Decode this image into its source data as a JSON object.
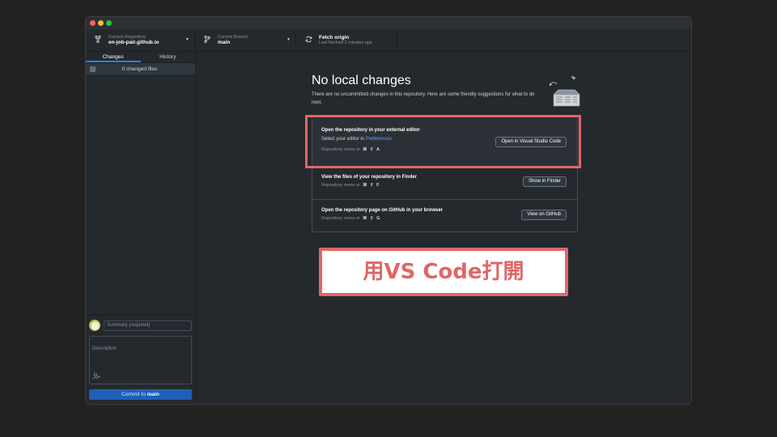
{
  "window": {
    "controls": [
      "close",
      "minimize",
      "zoom"
    ]
  },
  "toolbar": {
    "repo": {
      "label": "Current Repository",
      "value": "en-job-pair.github.io",
      "icon": "repo-icon"
    },
    "branch": {
      "label": "Current Branch",
      "value": "main",
      "icon": "branch-icon"
    },
    "fetch": {
      "label": "Fetch origin",
      "sub": "Last fetched 2 minutes ago",
      "icon": "sync-icon"
    }
  },
  "sidebar": {
    "tabs": [
      {
        "label": "Changes",
        "active": true
      },
      {
        "label": "History",
        "active": false
      }
    ],
    "changes_count_label": "0 changed files",
    "summary_placeholder": "Summary (required)",
    "description_placeholder": "Description",
    "commit_prefix": "Commit to ",
    "commit_branch": "main"
  },
  "main": {
    "heading": "No local changes",
    "subtext": "There are no uncommitted changes in this repository. Here are some friendly suggestions for what to do next.",
    "suggestions": [
      {
        "title": "Open the repository in your external editor",
        "sub_prefix": "Select your editor in ",
        "sub_link": "Preferences",
        "hint": "Repository menu or",
        "keys": "⌘ ⇧ A",
        "button": "Open in Visual Studio Code"
      },
      {
        "title": "View the files of your repository in Finder",
        "hint": "Repository menu or",
        "keys": "⌘ ⇧ F",
        "button": "Show in Finder"
      },
      {
        "title": "Open the repository page on GitHub in your browser",
        "hint": "Repository menu or",
        "keys": "⌘ ⇧ G",
        "button": "View on GitHub"
      }
    ]
  },
  "annotation": {
    "caption": "用VS Code打開",
    "accent": "#e06666"
  }
}
